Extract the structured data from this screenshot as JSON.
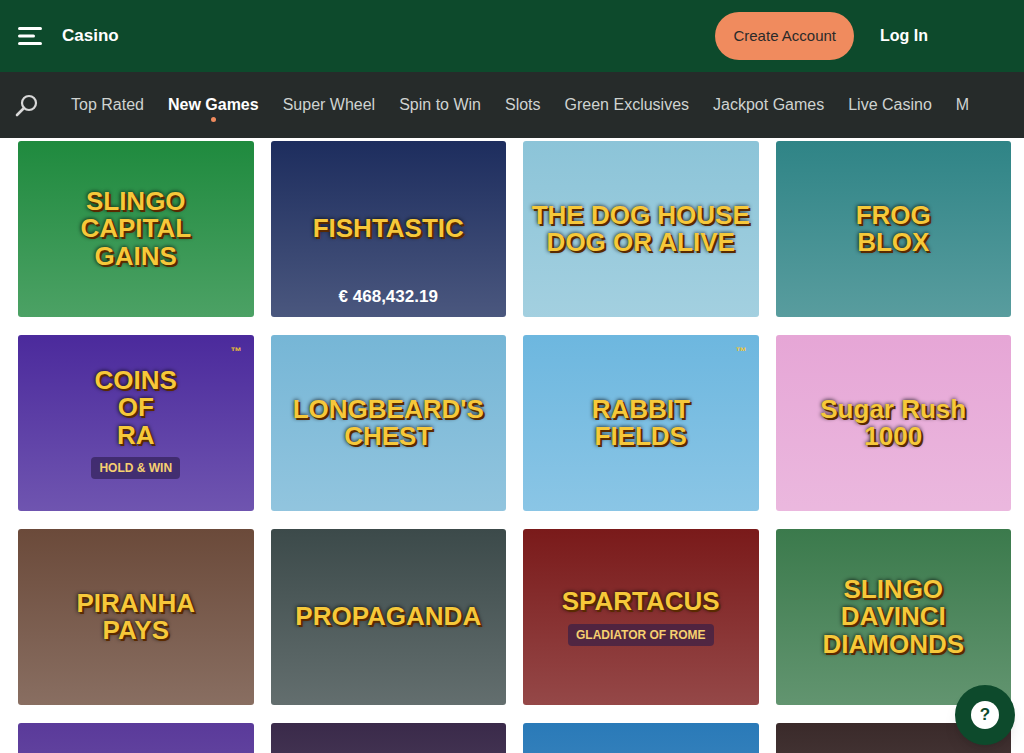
{
  "header": {
    "title": "Casino",
    "create_account": "Create Account",
    "log_in": "Log In"
  },
  "nav": {
    "items": [
      {
        "label": "Top Rated",
        "selected": false
      },
      {
        "label": "New Games",
        "selected": true
      },
      {
        "label": "Super Wheel",
        "selected": false
      },
      {
        "label": "Spin to Win",
        "selected": false
      },
      {
        "label": "Slots",
        "selected": false
      },
      {
        "label": "Green Exclusives",
        "selected": false
      },
      {
        "label": "Jackpot Games",
        "selected": false
      },
      {
        "label": "Live Casino",
        "selected": false
      },
      {
        "label": "M",
        "selected": false
      }
    ]
  },
  "games": [
    {
      "lines": [
        "SLINGO",
        "CAPITAL",
        "GAINS"
      ],
      "sub": "",
      "mark": "",
      "jackpot": "",
      "color": "#1f8a3e"
    },
    {
      "lines": [
        "FISHTASTIC"
      ],
      "sub": "",
      "mark": "",
      "jackpot": "€ 468,432.19",
      "color": "#1d2d5e"
    },
    {
      "lines": [
        "THE DOG HOUSE",
        "DOG OR ALIVE"
      ],
      "sub": "",
      "mark": "",
      "jackpot": "",
      "color": "#8cc4d8"
    },
    {
      "lines": [
        "FROG",
        "BLOX"
      ],
      "sub": "",
      "mark": "",
      "jackpot": "",
      "color": "#2f8486"
    },
    {
      "lines": [
        "COINS",
        "OF",
        "RA"
      ],
      "sub": "HOLD & WIN",
      "mark": "™",
      "jackpot": "",
      "color": "#4b2a9c"
    },
    {
      "lines": [
        "LONGBEARD'S",
        "CHEST"
      ],
      "sub": "",
      "mark": "",
      "jackpot": "",
      "color": "#76b6d6"
    },
    {
      "lines": [
        "RABBIT",
        "FIELDS"
      ],
      "sub": "",
      "mark": "™",
      "jackpot": "",
      "color": "#6db7df"
    },
    {
      "lines": [
        "Sugar Rush",
        "1000"
      ],
      "sub": "",
      "mark": "",
      "jackpot": "",
      "color": "#e6a6d6"
    },
    {
      "lines": [
        "PIRANHA",
        "PAYS"
      ],
      "sub": "",
      "mark": "",
      "jackpot": "",
      "color": "#6b4a3a"
    },
    {
      "lines": [
        "PROPAGANDA"
      ],
      "sub": "",
      "mark": "",
      "jackpot": "",
      "color": "#3c4a4a"
    },
    {
      "lines": [
        "SPARTACUS"
      ],
      "sub": "GLADIATOR OF ROME",
      "mark": "",
      "jackpot": "",
      "color": "#7a1a1a"
    },
    {
      "lines": [
        "SLINGO",
        "DAVINCI",
        "DIAMONDS"
      ],
      "sub": "",
      "mark": "",
      "jackpot": "",
      "color": "#3b7a4c"
    },
    {
      "lines": [],
      "sub": "",
      "mark": "",
      "jackpot": "",
      "color": "#5a3a9a"
    },
    {
      "lines": [],
      "sub": "",
      "mark": "",
      "jackpot": "",
      "color": "#3a2a4a"
    },
    {
      "lines": [],
      "sub": "",
      "mark": "",
      "jackpot": "",
      "color": "#2a7ab8"
    },
    {
      "lines": [],
      "sub": "",
      "mark": "",
      "jackpot": "",
      "color": "#3a2a2a"
    }
  ],
  "help_button": {
    "label": "?"
  }
}
